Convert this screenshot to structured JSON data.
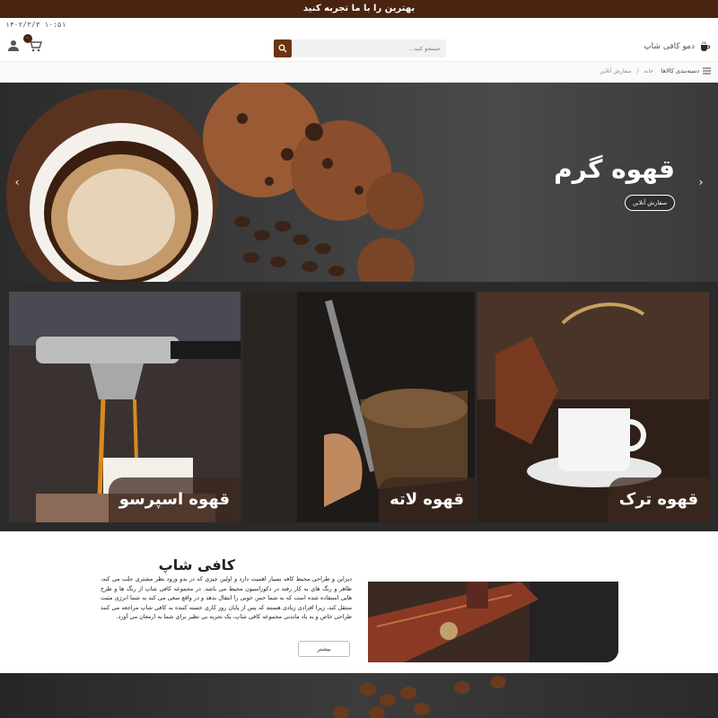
{
  "promo": {
    "text": "بهترین را با ما تجربه کنید"
  },
  "header": {
    "datetime": "۱۴۰۲/۳/۳ ۱۰:۵۱",
    "cart_count": "۰",
    "search_placeholder": "جستجو کنید...",
    "logo_text": "دمو کافی شاپ"
  },
  "nav": {
    "categories_label": "دسته‌بندی کالاها",
    "breadcrumbs": [
      "خانه",
      "سفارش آنلاین"
    ]
  },
  "hero": {
    "title": "قهوه گرم",
    "button_label": "سفارش آنلاین"
  },
  "tiles": [
    {
      "label": "قهوه ترک"
    },
    {
      "label": "قهوه لاته"
    },
    {
      "label": "قهوه اسپرسو"
    }
  ],
  "about": {
    "title": "کافی شاپ",
    "text": "دیزاین و طراحی محیط کافه بسیار اهمیت دارد و اولین چیزی که در بدو ورود نظر مشتری جلب می کند، ظاهر و رنگ های به کار رفته در دکوراسیون محیط می باشد. در مجموعه کافی  شاپ از رنگ ها و طرح هایی استفاده شده است که به شما حس خوبی را انتقال بدهد و در واقع سعی می کند به شما انرژی مثبت منتقل کند، زیرا افرادی زیادی هستند که پس از پایان روز کاری خسته کننده به کافی شاپ مراجعه می کنند  طراحی خاص و به یاد ماندنی مجموعه کافی شاپ، یک تجربه بی نظیر برای شما به ارمغان می آورد.",
    "button_label": "بیشتر"
  },
  "colors": {
    "brand_brown": "#4a2410",
    "search_button": "#6b3410"
  }
}
